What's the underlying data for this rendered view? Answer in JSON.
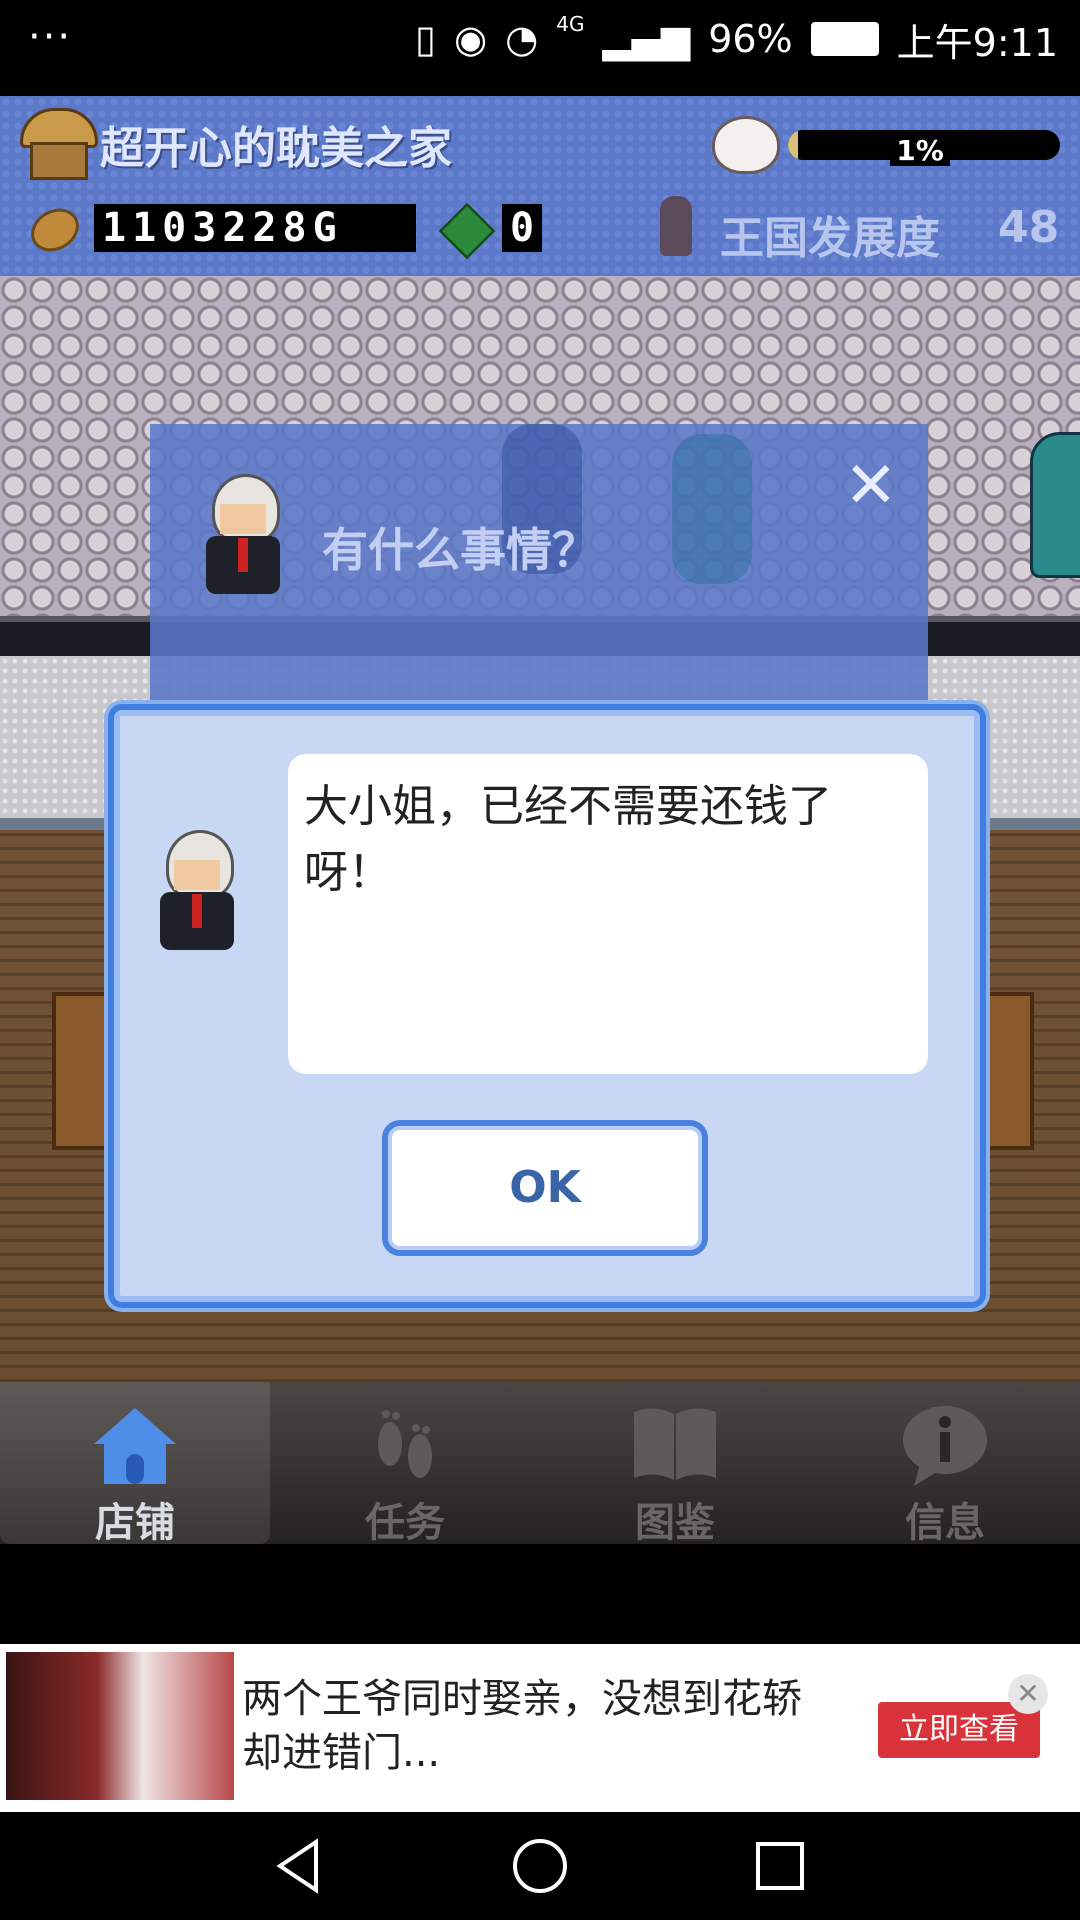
{
  "status_bar": {
    "menu": "···",
    "network": "4G",
    "battery": "96%",
    "time": "上午9:11"
  },
  "hud": {
    "shop_name": "超开心的耽美之家",
    "mood_percent": "1%",
    "mood_fraction": 0.01,
    "gold": "1103228G",
    "gems": "0",
    "kingdom_label": "王国发展度",
    "kingdom_value": "48"
  },
  "menu_panel": {
    "prompt": "有什么事情？",
    "close": "✕"
  },
  "dialog": {
    "message": "大小姐，已经不需要还钱了呀！",
    "ok_label": "OK"
  },
  "bottom_nav": {
    "items": [
      {
        "label": "店铺",
        "icon": "shop-home-icon",
        "active": true
      },
      {
        "label": "任务",
        "icon": "footprints-icon",
        "active": false
      },
      {
        "label": "图鉴",
        "icon": "book-icon",
        "active": false
      },
      {
        "label": "信息",
        "icon": "info-bubble-icon",
        "active": false
      }
    ]
  },
  "ad": {
    "text": "两个王爷同时娶亲，没想到花轿却进错门...",
    "button": "立即查看",
    "close": "✕"
  },
  "colors": {
    "hud_blue": "#5c78c8",
    "dialog_border": "#3f7ee0",
    "ad_button": "#d8333a"
  }
}
